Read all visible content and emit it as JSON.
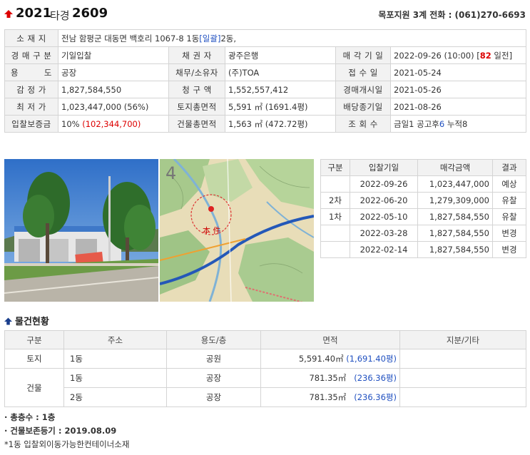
{
  "header": {
    "case_year": "2021",
    "case_type": "타경",
    "case_number": "2609",
    "court_info": "목포지원 3계 전화 : (061)270-6693"
  },
  "info": {
    "location": {
      "label": "소 재 지",
      "value": "전남 함평군 대동면 백호리 1067-8 1동",
      "link": "[일괄]",
      "suffix": "2동,"
    },
    "auction_type": {
      "label": "경 매 구 분",
      "value": "기일입찰"
    },
    "creditor": {
      "label": "채 권 자",
      "value": "광주은행"
    },
    "sale_date": {
      "label": "매 각 기 일",
      "value": "2022-09-26 (10:00) [",
      "dday": "82",
      "dday_suffix": " 일전]"
    },
    "usage": {
      "label": "용 도",
      "value": "공장"
    },
    "debtor_owner": {
      "label": "채무/소유자",
      "value": "(주)TOA"
    },
    "received": {
      "label": "접 수 일",
      "value": "2021-05-24"
    },
    "appraisal": {
      "label": "감 정 가",
      "value": "1,827,584,550"
    },
    "claim": {
      "label": "청 구 액",
      "value": "1,552,557,412"
    },
    "start_date": {
      "label": "경매개시일",
      "value": "2021-05-26"
    },
    "minimum": {
      "label": "최 저 가",
      "value": "1,023,447,000 (56%)"
    },
    "land_area": {
      "label": "토지총면적",
      "value": "5,591 ㎡ (1691.4평)"
    },
    "dividend_deadline": {
      "label": "배당종기일",
      "value": "2021-08-26"
    },
    "deposit": {
      "label": "입찰보증금",
      "value": "10%",
      "amount": "(102,344,700)"
    },
    "building_area": {
      "label": "건물총면적",
      "value": "1,563 ㎡ (472.72평)"
    },
    "views": {
      "label": "조 회 수",
      "text1": "금일1 공고후",
      "num": "6",
      "text2": " 누적8"
    }
  },
  "map": {
    "marker_label": "本 件",
    "page_number": "4"
  },
  "history": {
    "headers": [
      "구분",
      "입찰기일",
      "매각금액",
      "결과"
    ],
    "rows": [
      {
        "round": "",
        "date": "2022-09-26",
        "amount": "1,023,447,000",
        "result": "예상"
      },
      {
        "round": "2차",
        "date": "2022-06-20",
        "amount": "1,279,309,000",
        "result": "유찰"
      },
      {
        "round": "1차",
        "date": "2022-05-10",
        "amount": "1,827,584,550",
        "result": "유찰"
      },
      {
        "round": "",
        "date": "2022-03-28",
        "amount": "1,827,584,550",
        "result": "변경"
      },
      {
        "round": "",
        "date": "2022-02-14",
        "amount": "1,827,584,550",
        "result": "변경"
      }
    ]
  },
  "goods": {
    "title": "물건현황",
    "headers": [
      "구분",
      "주소",
      "용도/층",
      "면적",
      "지분/기타"
    ],
    "land": {
      "kind": "토지",
      "addr": "1동",
      "use": "공원",
      "area": "5,591.40㎡",
      "pyeong": "(1,691.40평)"
    },
    "building_kind": "건물",
    "buildings": [
      {
        "addr": "1동",
        "use": "공장",
        "area": "781.35㎡",
        "pyeong": "(236.36평)"
      },
      {
        "addr": "2동",
        "use": "공장",
        "area": "781.35㎡",
        "pyeong": "(236.36평)"
      }
    ]
  },
  "notes": {
    "floors": "· 총층수 : 1층",
    "registration": "· 건물보존등기 : 2019.08.09",
    "remark": "*1동 입찰외이동가능한컨테이너소재"
  },
  "colors": {
    "accent_red": "#dd0000",
    "link_blue": "#2050c0",
    "label_bg": "#f2f2f2",
    "border": "#d4d4d4"
  }
}
